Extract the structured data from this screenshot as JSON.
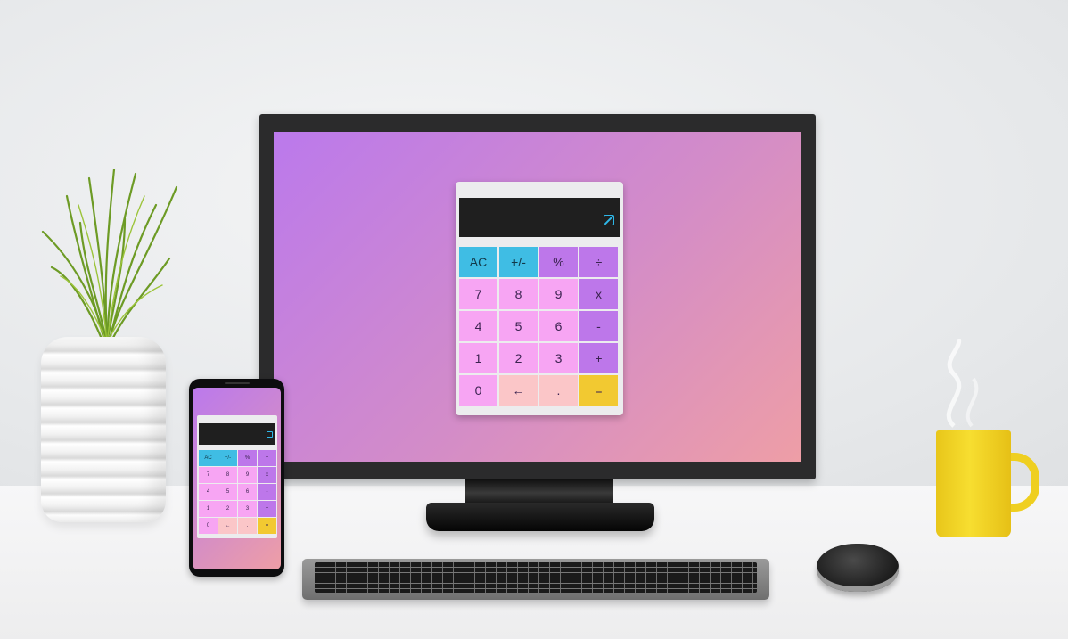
{
  "calculator": {
    "display_value": "",
    "rows": [
      [
        {
          "label": "AC",
          "style": "k-cyan"
        },
        {
          "label": "+/-",
          "style": "k-cyan"
        },
        {
          "label": "%",
          "style": "k-violet"
        },
        {
          "label": "÷",
          "style": "k-violet"
        }
      ],
      [
        {
          "label": "7",
          "style": "k-pink"
        },
        {
          "label": "8",
          "style": "k-pink"
        },
        {
          "label": "9",
          "style": "k-pink"
        },
        {
          "label": "x",
          "style": "k-violet"
        }
      ],
      [
        {
          "label": "4",
          "style": "k-pink"
        },
        {
          "label": "5",
          "style": "k-pink"
        },
        {
          "label": "6",
          "style": "k-pink"
        },
        {
          "label": "-",
          "style": "k-violet"
        }
      ],
      [
        {
          "label": "1",
          "style": "k-pink"
        },
        {
          "label": "2",
          "style": "k-pink"
        },
        {
          "label": "3",
          "style": "k-pink"
        },
        {
          "label": "+",
          "style": "k-violet"
        }
      ],
      [
        {
          "label": "0",
          "style": "k-pink"
        },
        {
          "label": "←",
          "style": "k-peach"
        },
        {
          "label": ".",
          "style": "k-peach"
        },
        {
          "label": "=",
          "style": "k-yellow"
        }
      ]
    ],
    "icon": "theme-toggle-icon"
  },
  "colors": {
    "gradient_start": "#bb79ec",
    "gradient_end": "#ee9ea6",
    "display_bg": "#1f1f1f",
    "accent_cyan": "#3fbde4",
    "operator_violet": "#bd77ea",
    "digit_pink": "#f7a5f3",
    "secondary_peach": "#fbc6c8",
    "equals_yellow": "#f2c931"
  }
}
